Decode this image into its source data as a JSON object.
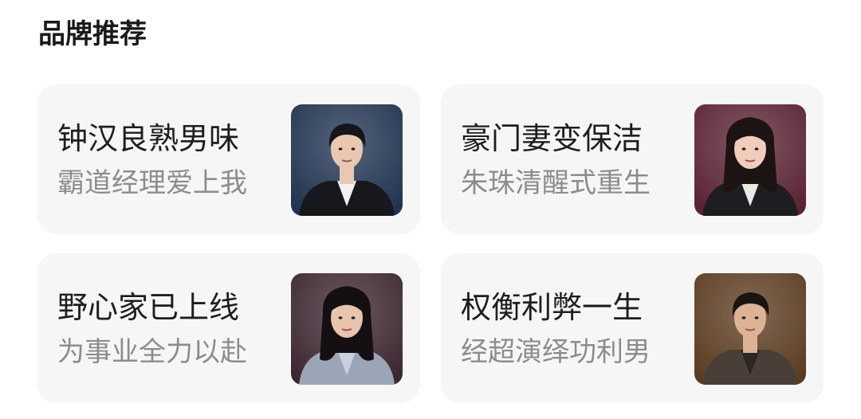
{
  "section": {
    "title": "品牌推荐"
  },
  "cards": [
    {
      "title": "钟汉良熟男味",
      "subtitle": "霸道经理爱上我",
      "thumb_icon": "man-in-suit-portrait",
      "palette": {
        "bg": "#1f3350",
        "hair": "#15161a",
        "skin": "#e9c8b0",
        "suit": "#17181c",
        "shirt": "#f1f1f1"
      }
    },
    {
      "title": "豪门妻变保洁",
      "subtitle": "朱珠清醒式重生",
      "thumb_icon": "woman-in-blazer-portrait",
      "palette": {
        "bg": "#5a2233",
        "hair": "#1c1412",
        "skin": "#efcdbb",
        "suit": "#1d1d22",
        "shirt": "#ece8e4"
      }
    },
    {
      "title": "野心家已上线",
      "subtitle": "为事业全力以赴",
      "thumb_icon": "woman-in-gray-blazer-portrait",
      "palette": {
        "bg": "#3c2630",
        "hair": "#141012",
        "skin": "#e6c4ad",
        "suit": "#9aa6b6",
        "shirt": "#c9d1dc"
      }
    },
    {
      "title": "权衡利弊一生",
      "subtitle": "经超演绎功利男",
      "thumb_icon": "man-in-brown-jacket-portrait",
      "palette": {
        "bg": "#5b3b20",
        "hair": "#1b1510",
        "skin": "#dcb394",
        "suit": "#4a3f38",
        "shirt": "#2a2623"
      }
    }
  ]
}
